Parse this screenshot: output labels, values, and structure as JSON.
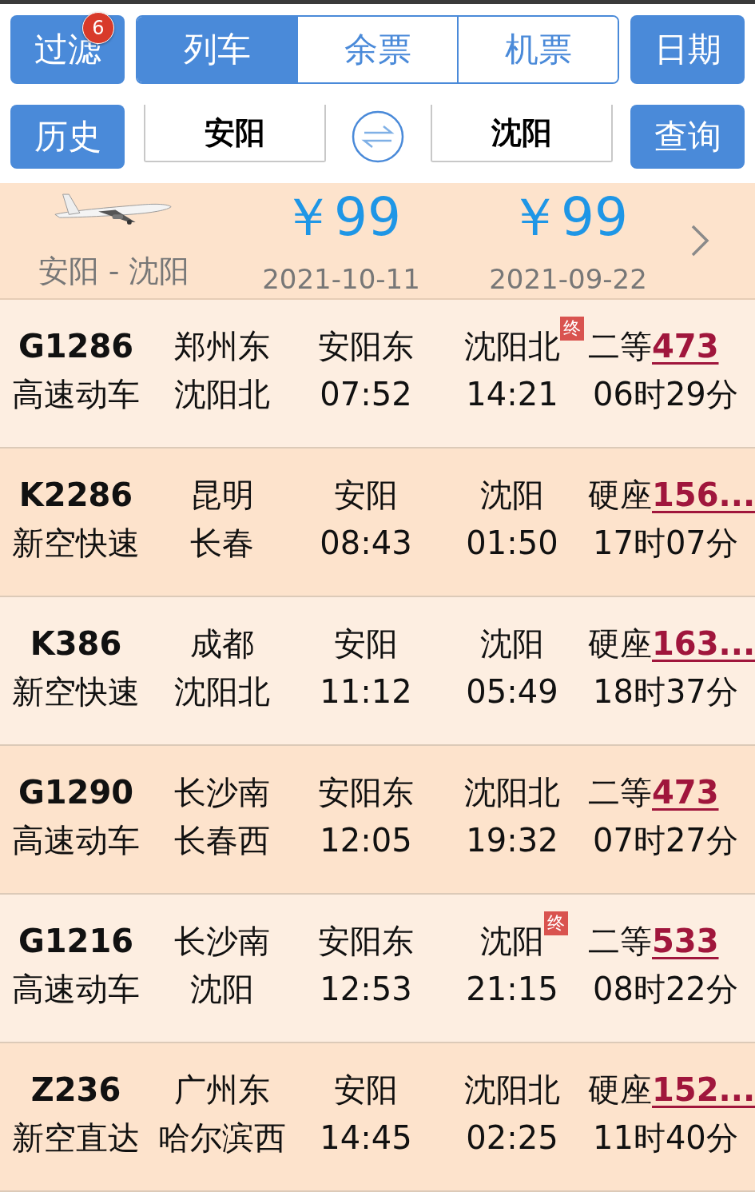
{
  "toolbar": {
    "filter": {
      "label": "过滤",
      "badge": "6"
    },
    "tabs": [
      {
        "label": "列车",
        "selected": true
      },
      {
        "label": "余票",
        "selected": false
      },
      {
        "label": "机票",
        "selected": false
      }
    ],
    "date_button": "日期"
  },
  "search": {
    "history_button": "历史",
    "from": "安阳",
    "to": "沈阳",
    "query_button": "查询"
  },
  "flight_banner": {
    "route": "安阳 - 沈阳",
    "offers": [
      {
        "price": "￥99",
        "date": "2021-10-11"
      },
      {
        "price": "￥99",
        "date": "2021-09-22"
      }
    ]
  },
  "trains": [
    {
      "number": "G1286",
      "type": "高速动车",
      "origin": "郑州东",
      "destination": "沈阳北",
      "depart_station": "安阳东",
      "depart_time": "07:52",
      "arrive_station": "沈阳北",
      "end_badge": "终",
      "arrive_time": "14:21",
      "seat": "二等",
      "price": "473",
      "duration": "06时29分"
    },
    {
      "number": "K2286",
      "type": "新空快速",
      "origin": "昆明",
      "destination": "长春",
      "depart_station": "安阳",
      "depart_time": "08:43",
      "arrive_station": "沈阳",
      "arrive_time": "01:50",
      "seat": "硬座",
      "price": "156...",
      "duration": "17时07分"
    },
    {
      "number": "K386",
      "type": "新空快速",
      "origin": "成都",
      "destination": "沈阳北",
      "depart_station": "安阳",
      "depart_time": "11:12",
      "arrive_station": "沈阳",
      "arrive_time": "05:49",
      "seat": "硬座",
      "price": "163...",
      "duration": "18时37分"
    },
    {
      "number": "G1290",
      "type": "高速动车",
      "origin": "长沙南",
      "destination": "长春西",
      "depart_station": "安阳东",
      "depart_time": "12:05",
      "arrive_station": "沈阳北",
      "arrive_time": "19:32",
      "seat": "二等",
      "price": "473",
      "duration": "07时27分"
    },
    {
      "number": "G1216",
      "type": "高速动车",
      "origin": "长沙南",
      "destination": "沈阳",
      "depart_station": "安阳东",
      "depart_time": "12:53",
      "arrive_station": "沈阳",
      "end_badge": "终",
      "arrive_time": "21:15",
      "seat": "二等",
      "price": "533",
      "duration": "08时22分"
    },
    {
      "number": "Z236",
      "type": "新空直达",
      "origin": "广州东",
      "destination": "哈尔滨西",
      "depart_station": "安阳",
      "depart_time": "14:45",
      "arrive_station": "沈阳北",
      "arrive_time": "02:25",
      "seat": "硬座",
      "price": "152...",
      "duration": "11时40分"
    }
  ]
}
